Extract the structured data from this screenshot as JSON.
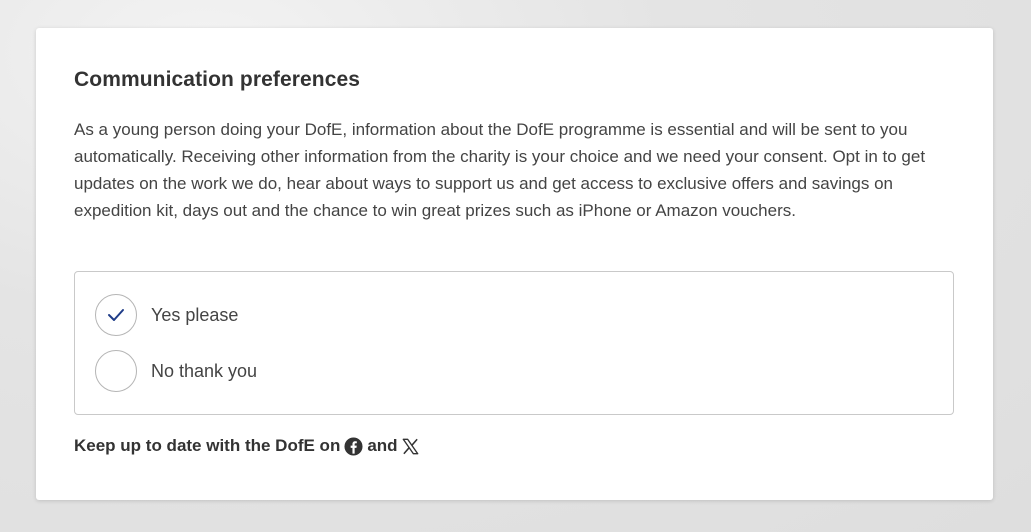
{
  "preferences": {
    "title": "Communication preferences",
    "intro": "As a young person doing your DofE, information about the DofE programme is essential and will be sent to you automatically. Receiving other information from the charity is your choice and we need your consent. Opt in to get updates on the work we do, hear about ways to support us and get access to exclusive offers and savings on expedition kit, days out and the chance to win great prizes such as iPhone or Amazon vouchers.",
    "options": [
      {
        "label": "Yes please",
        "selected": true
      },
      {
        "label": "No thank you",
        "selected": false
      }
    ],
    "social_prefix": "Keep up to date with the DofE on",
    "social_joiner": "and",
    "social_icons": [
      "facebook-icon",
      "x-twitter-icon"
    ]
  },
  "colors": {
    "checkmark": "#1f3c88",
    "radio_border": "#b5b5b5",
    "text": "#333333"
  }
}
